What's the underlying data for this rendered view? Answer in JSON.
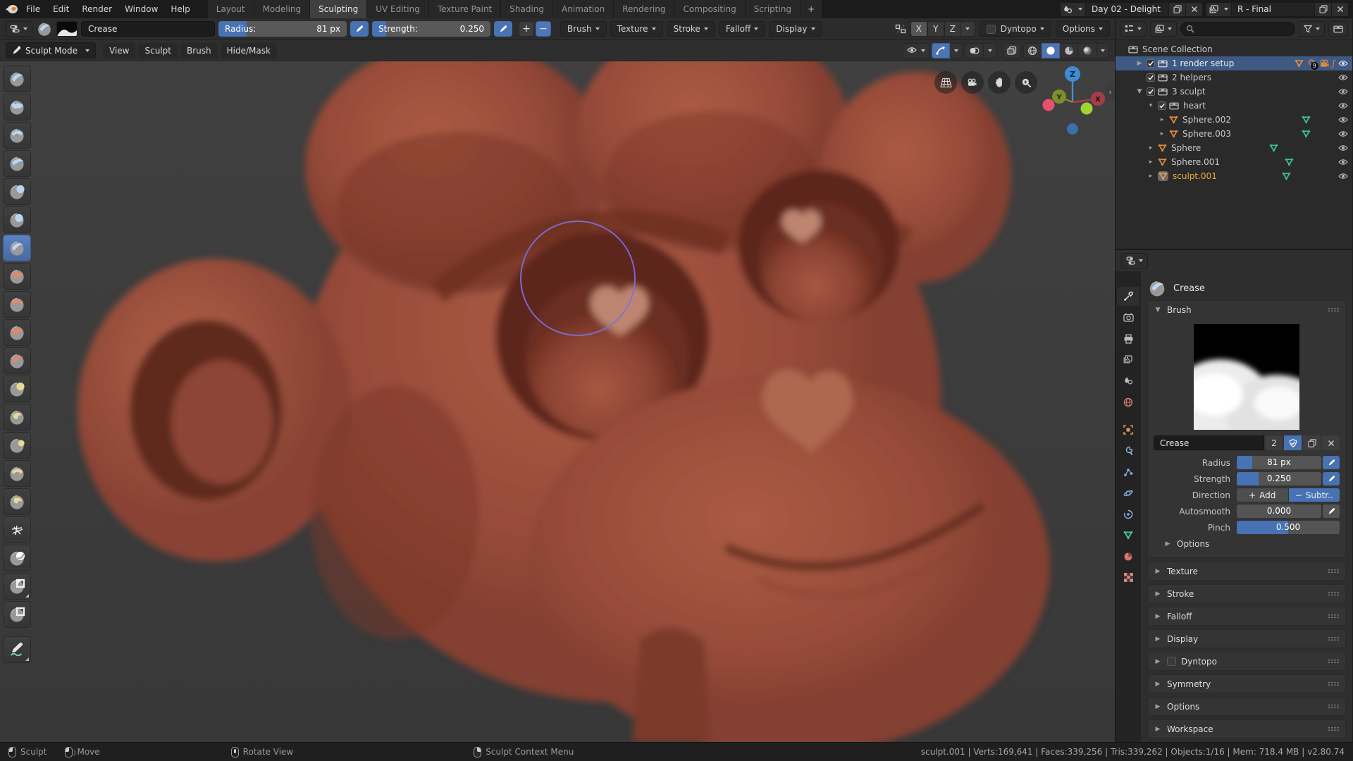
{
  "colors": {
    "accent": "#4772b3",
    "selection": "#3e5a84",
    "active_object": "#eda83f",
    "model_base": "#9c4f3b",
    "viewport_bg": "#3b3b3b",
    "cursor": "#7b70e0"
  },
  "topbar": {
    "menus": [
      "File",
      "Edit",
      "Render",
      "Window",
      "Help"
    ],
    "tabs": [
      "Layout",
      "Modeling",
      "Sculpting",
      "UV Editing",
      "Texture Paint",
      "Shading",
      "Animation",
      "Rendering",
      "Compositing",
      "Scripting"
    ],
    "active_tab": "Sculpting",
    "add_tab": "+",
    "scene_name": "Day 02 - Delight",
    "view_layer_name": "R - Final"
  },
  "tool_settings": {
    "brush_name": "Crease",
    "radius_label": "Radius:",
    "radius_value": "81 px",
    "strength_label": "Strength:",
    "strength_value": "0.250",
    "add_glyph": "+",
    "subtract_glyph": "−",
    "dropdowns": [
      "Brush",
      "Texture",
      "Stroke",
      "Falloff",
      "Display"
    ],
    "symmetry_axes": [
      "X",
      "Y",
      "Z"
    ],
    "dyntopo_label": "Dyntopo",
    "options_label": "Options"
  },
  "viewport_header": {
    "mode": "Sculpt Mode",
    "menus": [
      "View",
      "Sculpt",
      "Brush",
      "Hide/Mask"
    ]
  },
  "toolbar": {
    "active_tool": "crease",
    "tools": [
      "draw",
      "clay",
      "clay-strips",
      "layer",
      "inflate",
      "blob",
      "crease",
      "smooth",
      "flatten",
      "scrape",
      "pinch",
      "grab",
      "snake-hook",
      "thumb",
      "nudge",
      "rotate",
      "simplify",
      "mask",
      "box-hide",
      "box-mask",
      "annotate"
    ]
  },
  "gizmo": {
    "axes": [
      "Z",
      "Y",
      "X"
    ]
  },
  "outliner": {
    "rows": [
      {
        "label": "Scene Collection"
      },
      {
        "label": "1 render setup",
        "badge": "9",
        "selected": true
      },
      {
        "label": "2 helpers"
      },
      {
        "label": "3 sculpt"
      },
      {
        "label": "heart"
      },
      {
        "label": "Sphere.002"
      },
      {
        "label": "Sphere.003"
      },
      {
        "label": "Sphere"
      },
      {
        "label": "Sphere.001"
      },
      {
        "label": "sculpt.001",
        "active": true
      }
    ]
  },
  "properties": {
    "tabs": [
      "tool",
      "render",
      "output",
      "view-layer",
      "scene",
      "world",
      "object",
      "modifiers",
      "particles",
      "physics",
      "constraints",
      "data",
      "material",
      "texture"
    ],
    "active_tab": "tool",
    "title": "Crease",
    "brush_panel_label": "Brush",
    "name_value": "Crease",
    "users_count": "2",
    "radius_label": "Radius",
    "radius_value": "81 px",
    "strength_label": "Strength",
    "strength_value": "0.250",
    "direction_label": "Direction",
    "direction_add": "Add",
    "direction_subtract": "Subtr..",
    "autosmooth_label": "Autosmooth",
    "autosmooth_value": "0.000",
    "pinch_label": "Pinch",
    "pinch_value": "0.500",
    "options_subpanel": "Options",
    "panels": [
      "Texture",
      "Stroke",
      "Falloff",
      "Display",
      "Dyntopo",
      "Symmetry",
      "Options",
      "Workspace"
    ]
  },
  "statusbar": {
    "hints": [
      {
        "icon": "mouse-left",
        "label": "Sculpt"
      },
      {
        "icon": "mouse-drag",
        "label": "Move"
      },
      {
        "icon": "mouse-middle",
        "label": "Rotate View"
      },
      {
        "icon": "mouse-right",
        "label": "Sculpt Context Menu"
      }
    ],
    "stats": "sculpt.001 | Verts:169,641 | Faces:339,256 | Tris:339,262 | Objects:1/16 | Mem: 718.4 MB | v2.80.74"
  }
}
